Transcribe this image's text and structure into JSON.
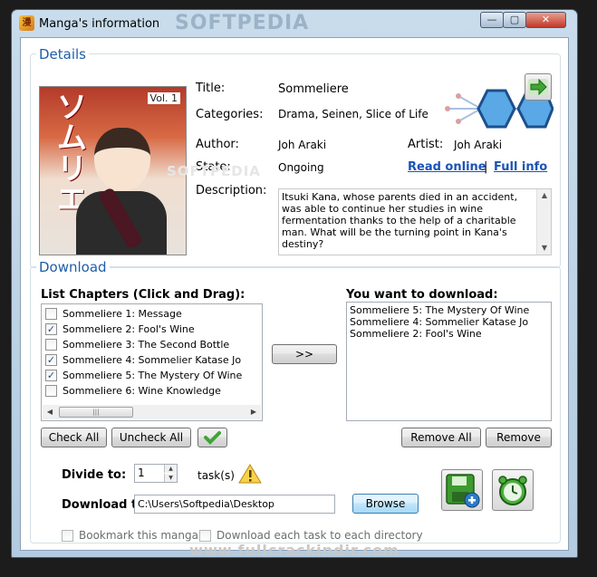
{
  "window": {
    "title": "Manga's information",
    "app_icon": "manga-app-icon"
  },
  "controls": {
    "minimize": "—",
    "maximize": "▢",
    "close": "✕"
  },
  "details": {
    "group_label": "Details",
    "title_label": "Title:",
    "title_value": "Sommeliere",
    "categories_label": "Categories:",
    "categories_value": "Drama, Seinen, Slice of Life",
    "author_label": "Author:",
    "author_value": "Joh Araki",
    "artist_label": "Artist:",
    "artist_value": "Joh Araki",
    "state_label": "State:",
    "state_value": "Ongoing",
    "read_online": "Read online",
    "separator": "|",
    "full_info": "Full info",
    "description_label": "Description:",
    "description_value": "Itsuki Kana, whose parents died in an accident, was able to continue her studies in wine fermentation thanks to the help of a charitable man. What will be the turning point in Kana's destiny?",
    "cover": {
      "title": "ソムリエ",
      "volume": "Vol. 1"
    }
  },
  "download": {
    "group_label": "Download",
    "list_label": "List Chapters (Click and Drag):",
    "chapters": [
      {
        "label": "Sommeliere 1: Message",
        "checked": false
      },
      {
        "label": "Sommeliere 2: Fool's Wine",
        "checked": true
      },
      {
        "label": "Sommeliere 3: The Second Bottle",
        "checked": false
      },
      {
        "label": "Sommeliere 4: Sommelier Katase Jo",
        "checked": true
      },
      {
        "label": "Sommeliere 5: The Mystery Of Wine",
        "checked": true
      },
      {
        "label": "Sommeliere 6: Wine Knowledge",
        "checked": false
      }
    ],
    "want_label": "You want to download:",
    "queued": [
      "Sommeliere 5: The Mystery Of Wine",
      "Sommeliere 4: Sommelier Katase Jo",
      "Sommeliere 2: Fool's Wine"
    ],
    "move_button": ">>",
    "check_all": "Check All",
    "uncheck_all": "Uncheck All",
    "remove_all": "Remove All",
    "remove": "Remove",
    "divide_label": "Divide to:",
    "divide_value": "1",
    "tasks_label": "task(s)",
    "download_to_label": "Download to:",
    "download_path": "C:\\Users\\Softpedia\\Desktop",
    "browse": "Browse",
    "bookmark": "Bookmark this manga",
    "each_directory": "Download each task to each directory"
  },
  "watermarks": {
    "top": "SOFTPEDIA",
    "bottom": "www.fullcrackindir.com"
  },
  "colors": {
    "accent": "#1e5ea8",
    "link": "#1a53b8",
    "check_green": "#3fa535"
  }
}
